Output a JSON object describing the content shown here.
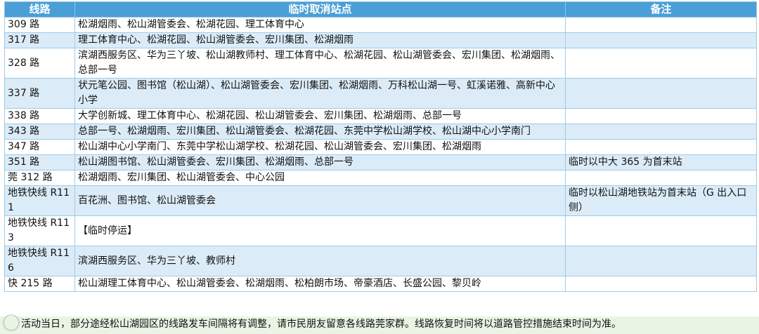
{
  "table": {
    "headers": [
      "线路",
      "临时取消站点",
      "备注"
    ],
    "rows": [
      {
        "line": "309 路",
        "stops": "松湖烟雨、松山湖管委会、松湖花园、理工体育中心",
        "note": ""
      },
      {
        "line": "317 路",
        "stops": "理工体育中心、松湖花园、松山湖管委会、宏川集团、松湖烟雨",
        "note": ""
      },
      {
        "line": "328 路",
        "stops": "滨湖西服务区、华为三丫坡、松山湖教师村、理工体育中心、松湖花园、松山湖管委会、宏川集团、松湖烟雨、总部一号",
        "note": ""
      },
      {
        "line": "337 路",
        "stops": "状元笔公园、图书馆（松山湖）、松山湖管委会、宏川集团、松湖烟雨、万科松山湖一号、虹溪诺雅、高新中心小学",
        "note": ""
      },
      {
        "line": "338 路",
        "stops": "大学创新城、理工体育中心、松湖花园、松山湖管委会、宏川集团、松湖烟雨、总部一号",
        "note": ""
      },
      {
        "line": "343 路",
        "stops": "总部一号、松湖烟雨、宏川集团、松山湖管委会、松湖花园、东莞中学松山湖学校、松山湖中心小学南门",
        "note": ""
      },
      {
        "line": "347 路",
        "stops": "松山湖中心小学南门、东莞中学松山湖学校、松湖花园、松山湖管委会、宏川集团、松湖烟雨",
        "note": ""
      },
      {
        "line": "351 路",
        "stops": "松山湖图书馆、松山湖管委会、宏川集团、松湖烟雨、总部一号",
        "note": "临时以中大 365 为首末站"
      },
      {
        "line": "莞 312 路",
        "stops": "松湖烟雨、宏川集团、松山湖管委会、中心公园",
        "note": ""
      },
      {
        "line": "地铁快线 R111",
        "stops": "百花洲、图书馆、松山湖管委会",
        "note": "临时以松山湖地铁站为首末站（G 出入口侧）"
      },
      {
        "line": "地铁快线 R113",
        "stops": "【临时停运】",
        "note": ""
      },
      {
        "line": "地铁快线 R116",
        "stops": "滨湖西服务区、华为三丫坡、教师村",
        "note": ""
      },
      {
        "line": "快 215 路",
        "stops": "松山湖理工体育中心、松山湖管委会、松湖烟雨、松柏朗市场、帝豪酒店、长盛公园、黎贝岭",
        "note": ""
      }
    ]
  },
  "footer_text": "活动当日，部分途经松山湖园区的线路发车间隔将有调整，请市民朋友留意各线路莞家群。线路恢复时间将以道路管控措施结束时间为准。",
  "colors": {
    "header_bg": "#4a9fd6",
    "row_alt_bg": "#dbecf8",
    "footer_bg": "#e9f4e4"
  }
}
